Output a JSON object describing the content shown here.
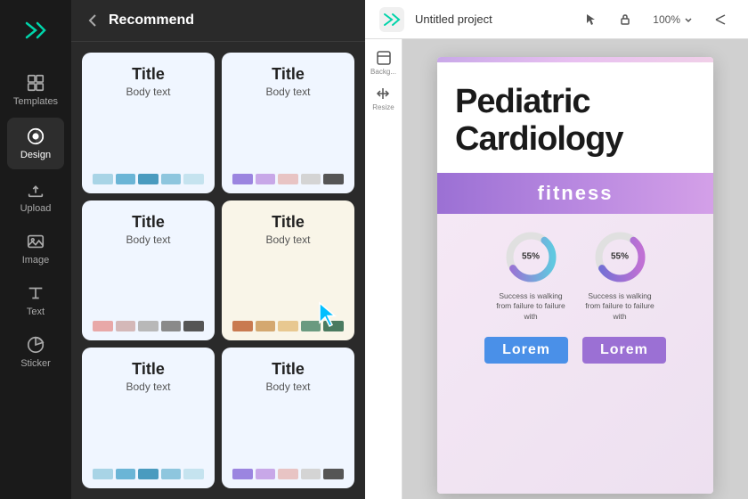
{
  "sidebar": {
    "logo_text": "✂",
    "items": [
      {
        "id": "templates",
        "label": "Templates",
        "icon": "templates"
      },
      {
        "id": "design",
        "label": "Design",
        "icon": "design",
        "active": true
      },
      {
        "id": "upload",
        "label": "Upload",
        "icon": "upload"
      },
      {
        "id": "image",
        "label": "Image",
        "icon": "image"
      },
      {
        "id": "text",
        "label": "Text",
        "icon": "text"
      },
      {
        "id": "sticker",
        "label": "Sticker",
        "icon": "sticker"
      }
    ]
  },
  "panel": {
    "back_label": "Recommend",
    "templates": [
      {
        "id": 1,
        "title": "Title",
        "body": "Body text",
        "bg": "blue",
        "swatches": "blue"
      },
      {
        "id": 2,
        "title": "Title",
        "body": "Body text",
        "bg": "blue",
        "swatches": "purple"
      },
      {
        "id": 3,
        "title": "Title",
        "body": "Body text",
        "bg": "blue",
        "swatches": "pink"
      },
      {
        "id": 4,
        "title": "Title",
        "body": "Body text",
        "bg": "cream",
        "swatches": "warm",
        "cursor": true
      },
      {
        "id": 5,
        "title": "Title",
        "body": "Body text",
        "bg": "blue",
        "swatches": "blue"
      },
      {
        "id": 6,
        "title": "Title",
        "body": "Body text",
        "bg": "blue",
        "swatches": "purple"
      }
    ]
  },
  "canvas": {
    "header": {
      "project_name": "Untitled project",
      "zoom_level": "100%",
      "cursor_icon": "▶",
      "lock_icon": "🔒"
    },
    "tools": [
      {
        "id": "background",
        "label": "Backg..."
      },
      {
        "id": "resize",
        "label": "Resize"
      }
    ],
    "design": {
      "main_title": "Pediatric Cardiology",
      "subtitle": "fitness",
      "chart1_pct": "55%",
      "chart2_pct": "55%",
      "chart_desc": "Success is walking from failure to failure with",
      "lorem_btn1": "Lorem",
      "lorem_btn2": "Lorem"
    }
  }
}
